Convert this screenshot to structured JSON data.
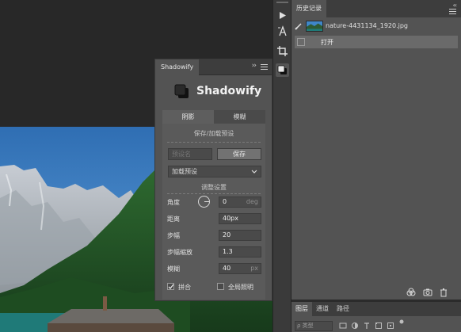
{
  "shadowify": {
    "panel_tab": "Shadowify",
    "collapse": "››",
    "title": "Shadowify",
    "tabs": [
      "阴影",
      "模糊"
    ],
    "section_preset": "保存/加载预设",
    "preset_placeholder": "预设名",
    "save_label": "保存",
    "load_preset": "加载预设",
    "section_adjust": "调整设置",
    "fields": {
      "angle": {
        "label": "角度",
        "value": "0",
        "unit": "deg"
      },
      "distance": {
        "label": "距离",
        "value": "40px"
      },
      "steps": {
        "label": "步幅",
        "value": "20"
      },
      "step_scale": {
        "label": "步幅缩放",
        "value": "1.3"
      },
      "blur": {
        "label": "模糊",
        "value": "40",
        "unit": "px"
      }
    },
    "merge_label": "拼合",
    "merge_checked": true,
    "global_light_label": "全局照明",
    "global_light_checked": false
  },
  "history": {
    "tab": "历史记录",
    "collapse": "‹‹",
    "snapshot_file": "nature-4431134_1920.jpg",
    "step": "打开"
  },
  "layers": {
    "tabs": [
      "图层",
      "通道",
      "路径"
    ],
    "kind_placeholder": "ρ 类型"
  },
  "tools": [
    "play-icon",
    "character-icon",
    "crop-icon",
    "shadowify-icon"
  ],
  "colors": {
    "panel_bg": "#535353",
    "tab_bar": "#3d3d3d",
    "canvas_bg": "#282828",
    "sky": "#3f86c8",
    "forest": "#1f4a22"
  }
}
